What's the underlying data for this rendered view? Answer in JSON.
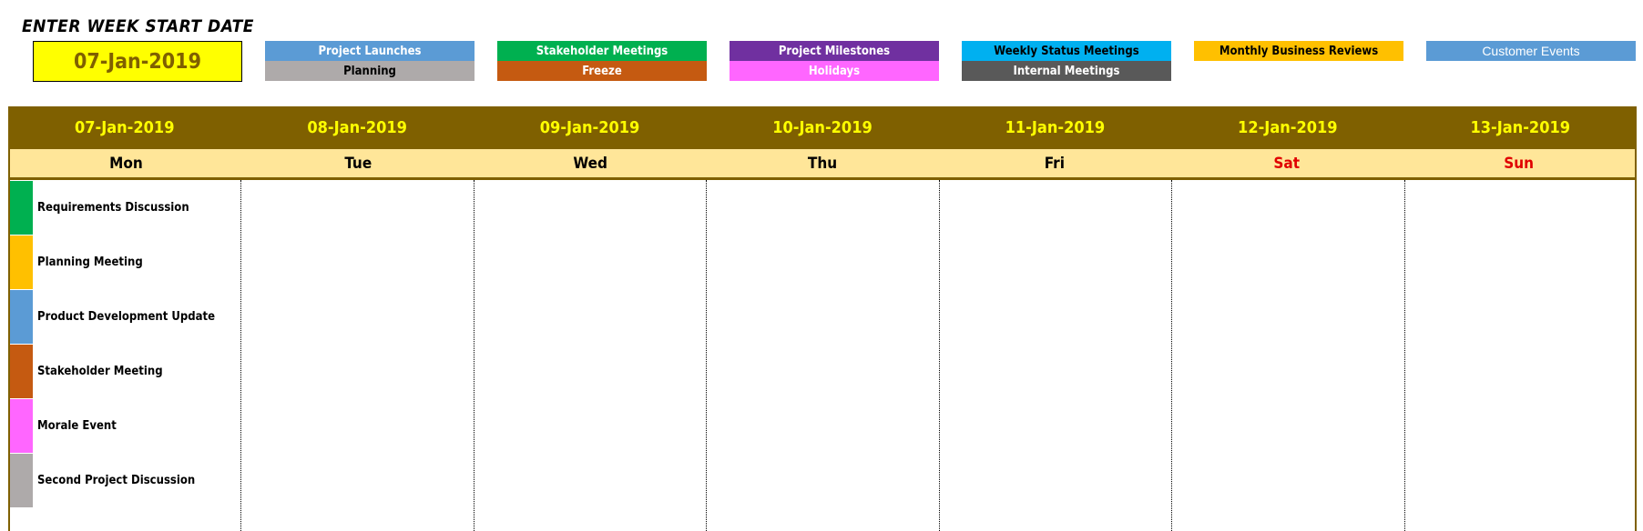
{
  "header": {
    "title": "ENTER WEEK START DATE",
    "start_date": "07-Jan-2019"
  },
  "legend": [
    {
      "top": {
        "label": "Project Launches",
        "bg": "#5b9bd5",
        "fg": "#ffffff"
      },
      "bottom": {
        "label": "Planning",
        "bg": "#aeaaaa",
        "fg": "#000000"
      }
    },
    {
      "top": {
        "label": "Stakeholder Meetings",
        "bg": "#00b050",
        "fg": "#ffffff"
      },
      "bottom": {
        "label": "Freeze",
        "bg": "#c55a11",
        "fg": "#ffffff"
      }
    },
    {
      "top": {
        "label": "Project Milestones",
        "bg": "#7030a0",
        "fg": "#ffffff"
      },
      "bottom": {
        "label": "Holidays",
        "bg": "#ff66ff",
        "fg": "#ffffff"
      }
    },
    {
      "top": {
        "label": "Weekly Status Meetings",
        "bg": "#00b0f0",
        "fg": "#000000"
      },
      "bottom": {
        "label": "Internal Meetings",
        "bg": "#595959",
        "fg": "#ffffff"
      }
    },
    {
      "top": {
        "label": "Monthly Business Reviews",
        "bg": "#ffc000",
        "fg": "#000000"
      }
    },
    {
      "top": {
        "label": "Customer Events",
        "bg": "#5b9bd5",
        "fg": "#ffffff"
      }
    }
  ],
  "calendar": {
    "days": [
      {
        "date": "07-Jan-2019",
        "day": "Mon",
        "weekend": false
      },
      {
        "date": "08-Jan-2019",
        "day": "Tue",
        "weekend": false
      },
      {
        "date": "09-Jan-2019",
        "day": "Wed",
        "weekend": false
      },
      {
        "date": "10-Jan-2019",
        "day": "Thu",
        "weekend": false
      },
      {
        "date": "11-Jan-2019",
        "day": "Fri",
        "weekend": false
      },
      {
        "date": "12-Jan-2019",
        "day": "Sat",
        "weekend": true
      },
      {
        "date": "13-Jan-2019",
        "day": "Sun",
        "weekend": true
      }
    ],
    "colors": {
      "date_header_bg": "#7f6000",
      "date_header_text": "#ffff00",
      "day_header_bg": "#ffe699",
      "weekend_text": "#e00000"
    },
    "events": [
      {
        "label": "Requirements Discussion",
        "color": "#00b050"
      },
      {
        "label": "Planning Meeting",
        "color": "#ffc000"
      },
      {
        "label": "Product Development Update",
        "color": "#5b9bd5"
      },
      {
        "label": "Stakeholder Meeting",
        "color": "#c55a11"
      },
      {
        "label": "Morale Event",
        "color": "#ff66ff"
      },
      {
        "label": "Second Project Discussion",
        "color": "#aeaaaa"
      }
    ]
  }
}
